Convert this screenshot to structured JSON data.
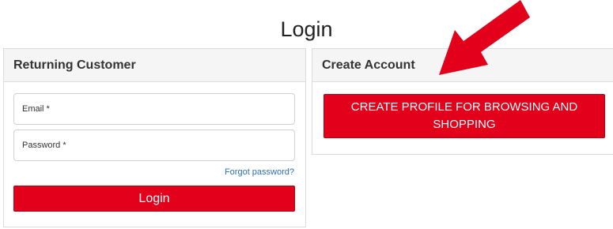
{
  "page": {
    "title": "Login"
  },
  "returning_customer": {
    "header": "Returning Customer",
    "email_placeholder": "Email *",
    "password_placeholder": "Password *",
    "forgot_password": "Forgot password?",
    "login_button": "Login"
  },
  "create_account": {
    "header": "Create Account",
    "create_button": "CREATE PROFILE FOR BROWSING AND SHOPPING"
  },
  "colors": {
    "accent_red": "#e3001b",
    "link_blue": "#2a6fb8",
    "annotation_arrow": "#e3001b"
  },
  "annotation": {
    "icon": "arrow-pointer-icon"
  }
}
